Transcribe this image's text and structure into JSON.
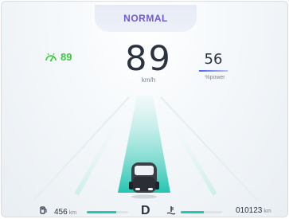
{
  "header": {
    "mode": "NORMAL"
  },
  "eco": {
    "icon": "eco-driving-icon",
    "value": "89",
    "color": "#3cc93f"
  },
  "speed": {
    "value": "89",
    "unit": "km/h"
  },
  "power": {
    "value": "56",
    "unit": "%power"
  },
  "status_bar": {
    "range": {
      "icon": "fuel-pump-icon",
      "value": "456",
      "unit": "km",
      "level": 0.72
    },
    "gear": "D",
    "temperature": {
      "icon": "coolant-temp-icon",
      "level": 0.55
    },
    "odometer": {
      "value": "010123",
      "unit": "km"
    }
  },
  "colors": {
    "accent": "#22c6b2",
    "mode_text": "#6f5bd6",
    "power_line": "#4a68e8"
  }
}
